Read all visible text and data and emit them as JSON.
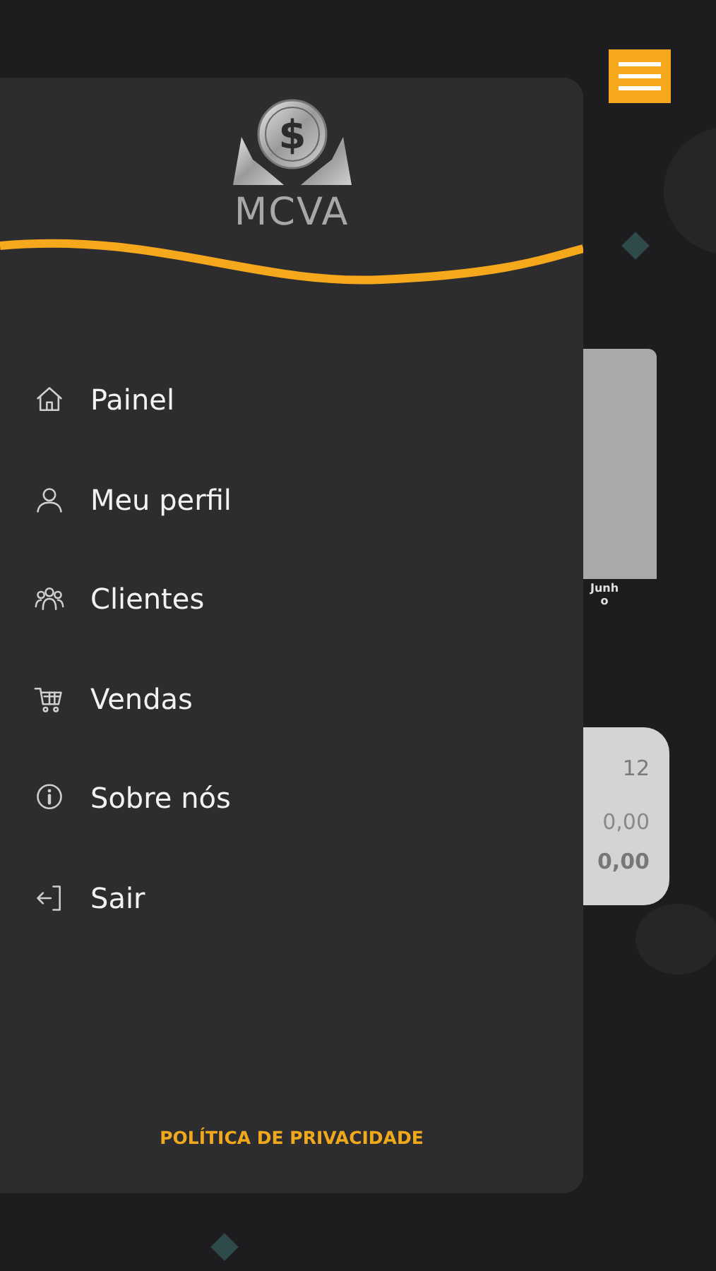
{
  "background": {
    "chart_label": "Junho",
    "card": {
      "count": "12",
      "value_1": "0,00",
      "value_2": "0,00"
    }
  },
  "drawer": {
    "logo": {
      "symbol": "$",
      "text": "MCVA"
    },
    "menu": [
      {
        "kind": "home",
        "label": "Painel"
      },
      {
        "kind": "profile",
        "label": "Meu perfil"
      },
      {
        "kind": "clients",
        "label": "Clientes"
      },
      {
        "kind": "sales",
        "label": "Vendas"
      },
      {
        "kind": "about",
        "label": "Sobre nós"
      },
      {
        "kind": "logout",
        "label": "Sair"
      }
    ],
    "footer_link": "POLÍTICA DE PRIVACIDADE"
  }
}
